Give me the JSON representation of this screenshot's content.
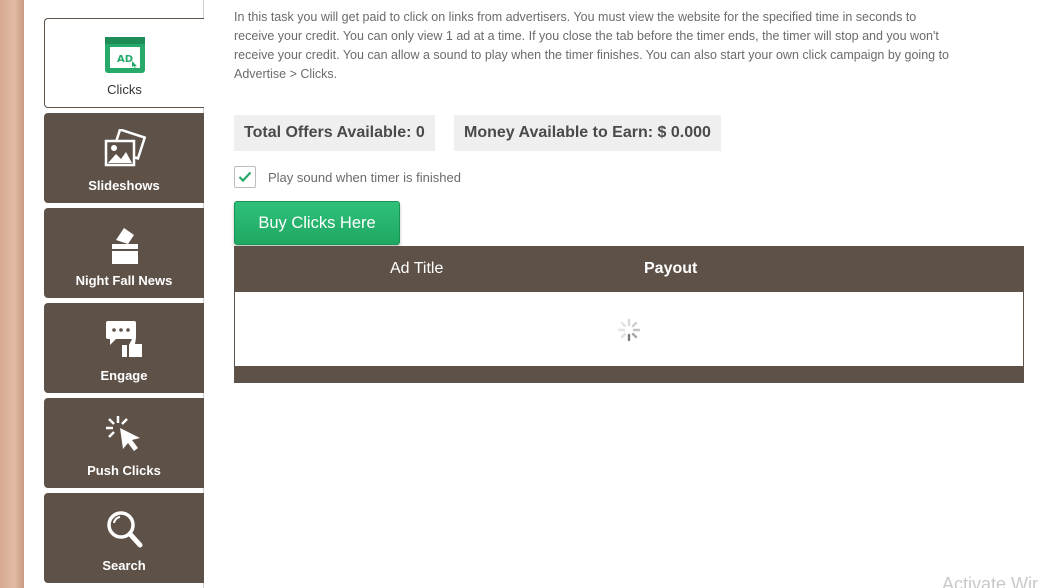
{
  "sidebar": {
    "items": [
      {
        "label": "Clicks",
        "icon": "ad-icon",
        "active": true
      },
      {
        "label": "Slideshows",
        "icon": "slideshow-icon",
        "active": false
      },
      {
        "label": "Night Fall News",
        "icon": "ballot-box-icon",
        "active": false
      },
      {
        "label": "Engage",
        "icon": "engage-icon",
        "active": false
      },
      {
        "label": "Push Clicks",
        "icon": "cursor-click-icon",
        "active": false
      },
      {
        "label": "Search",
        "icon": "search-icon",
        "active": false
      }
    ]
  },
  "main": {
    "intro_line1": "In this task you will get paid to click on links from advertisers. You must view the website for the specified time in seconds to",
    "intro_line2": "receive your credit. You can only view 1 ad at a time. If you close the tab before the timer ends, the timer will stop and you won't",
    "intro_line3": "receive your credit. You can allow a sound to play when the timer finishes. You can also start your own click campaign by going to",
    "intro_line4": "Advertise > Clicks.",
    "total_offers": "Total Offers Available: 0",
    "money_available": "Money Available to Earn: $ 0.000",
    "sound_checkbox_label": "Play sound when timer is finished",
    "sound_checked": true,
    "buy_button": "Buy Clicks Here",
    "table": {
      "columns": [
        "Ad Title",
        "Payout"
      ]
    }
  },
  "watermark": "Activate Wir",
  "colors": {
    "tile_bg": "#5e5148",
    "accent_green": "#1fa862",
    "ad_icon_green": "#27a96a"
  }
}
